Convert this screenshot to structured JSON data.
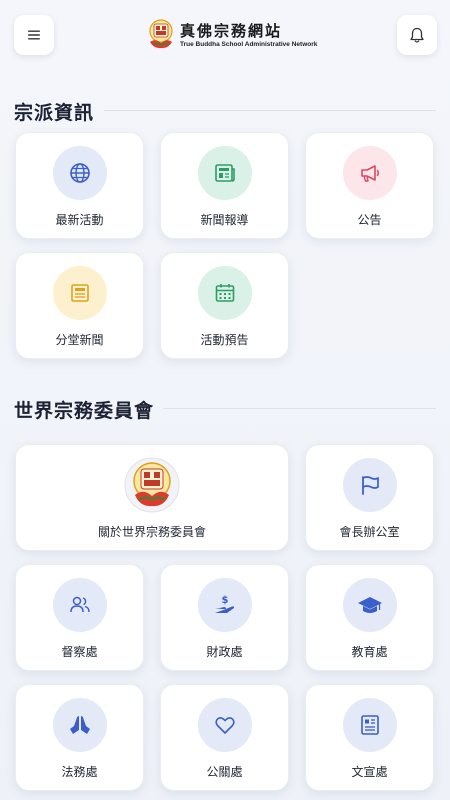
{
  "header": {
    "logo_cn": "真佛宗務網站",
    "logo_en": "True Buddha School Administrative Network",
    "menu_icon": "menu-icon",
    "bell_icon": "bell-icon"
  },
  "sections": {
    "info": {
      "title": "宗派資訊",
      "items": [
        {
          "label": "最新活動",
          "icon": "globe-icon",
          "color": "#3a5fc8"
        },
        {
          "label": "新聞報導",
          "icon": "newspaper-icon",
          "color": "#2f9c68"
        },
        {
          "label": "公告",
          "icon": "megaphone-icon",
          "color": "#d94a63"
        },
        {
          "label": "分堂新聞",
          "icon": "news-icon",
          "color": "#e0a21d"
        },
        {
          "label": "活動預告",
          "icon": "calendar-icon",
          "color": "#2f9c68"
        }
      ]
    },
    "committee": {
      "title": "世界宗務委員會",
      "items": [
        {
          "label": "關於世界宗務委員會",
          "icon": "emblem-icon"
        },
        {
          "label": "會長辦公室",
          "icon": "flag-icon",
          "color": "#3a5fc8"
        },
        {
          "label": "督察處",
          "icon": "users-icon",
          "color": "#3a5fc8"
        },
        {
          "label": "財政處",
          "icon": "hand-dollar-icon",
          "color": "#3a5fc8"
        },
        {
          "label": "教育處",
          "icon": "graduation-cap-icon",
          "color": "#3a5fc8"
        },
        {
          "label": "法務處",
          "icon": "praying-hands-icon",
          "color": "#3a5fc8"
        },
        {
          "label": "公關處",
          "icon": "heart-icon",
          "color": "#3a5fc8"
        },
        {
          "label": "文宣處",
          "icon": "document-icon",
          "color": "#3a5fc8"
        }
      ]
    }
  }
}
